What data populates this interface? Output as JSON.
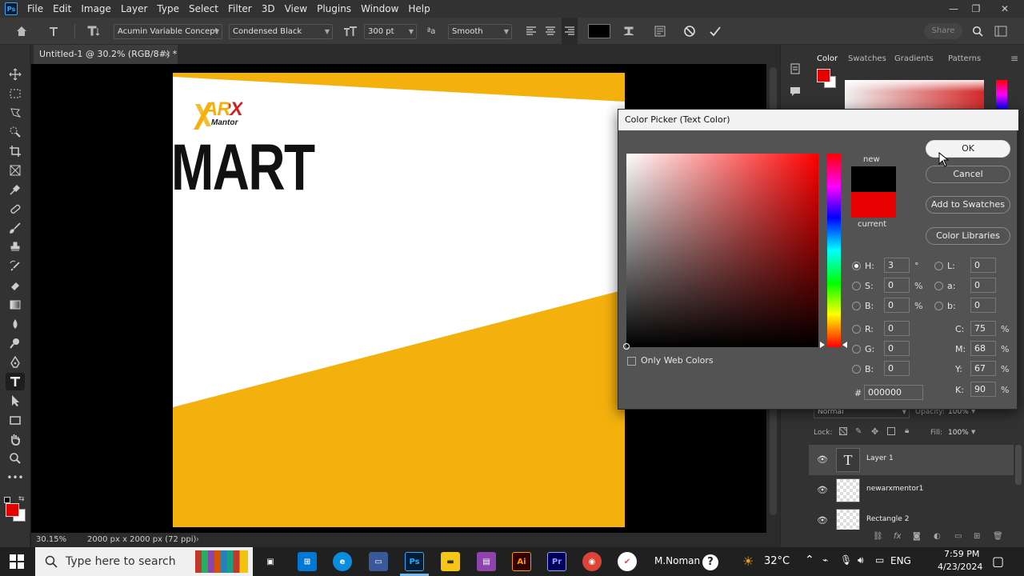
{
  "app": {
    "logo": "Ps",
    "menu": [
      "File",
      "Edit",
      "Image",
      "Layer",
      "Type",
      "Select",
      "Filter",
      "3D",
      "View",
      "Plugins",
      "Window",
      "Help"
    ],
    "window_controls": {
      "minimize": "—",
      "maximize": "❐",
      "close": "✕"
    }
  },
  "options_bar": {
    "font_family": "Acumin Variable Concept",
    "font_style": "Condensed Black",
    "font_size": "300 pt",
    "aa_label": "ªa",
    "anti_alias": "Smooth",
    "share": "Share",
    "text_color": "#000000"
  },
  "document": {
    "tab_title": "Untitled-1 @ 30.2% (RGB/8#) *",
    "headline_text": "MART",
    "logo_letters": "ARX",
    "logo_sub": "Mantor",
    "accent_color": "#f4b10d",
    "zoom": "30.15%",
    "doc_size": "2000 px x 2000 px (72 ppi)"
  },
  "right_panel": {
    "tabs": [
      "Color",
      "Swatches",
      "Gradients",
      "Patterns"
    ],
    "foreground_color": "#e60000",
    "blend_mode": "Normal",
    "opacity_label": "Opacity:",
    "opacity": "100%",
    "lock_label": "Lock:",
    "fill_label": "Fill:",
    "fill": "100%",
    "layers": [
      {
        "name": "Layer 1",
        "type": "text",
        "selected": true
      },
      {
        "name": "newarxmentor1",
        "type": "smart",
        "selected": false
      },
      {
        "name": "Rectangle 2",
        "type": "shape",
        "selected": false
      }
    ]
  },
  "color_picker": {
    "title": "Color Picker (Text Color)",
    "new_label": "new",
    "current_label": "current",
    "new_color": "#000000",
    "current_color": "#e60000",
    "buttons": {
      "ok": "OK",
      "cancel": "Cancel",
      "add_swatches": "Add to Swatches",
      "libraries": "Color Libraries"
    },
    "only_web_colors": "Only Web Colors",
    "fields": {
      "H": "3",
      "S": "0",
      "B": "0",
      "R": "0",
      "G": "0",
      "B2": "0",
      "L": "0",
      "a": "0",
      "b": "0",
      "C": "75",
      "M": "68",
      "Y": "67",
      "K": "90"
    },
    "units": {
      "deg": "°",
      "pct": "%"
    },
    "hex_label": "#",
    "hex": "000000"
  },
  "taskbar": {
    "search_placeholder": "Type here to search",
    "user": "M.Noman",
    "temperature": "32°C",
    "language": "ENG",
    "time": "7:59 PM",
    "date": "4/23/2024",
    "app_labels": {
      "photoshop": "Ps",
      "illustrator": "Ai",
      "premiere": "Pr"
    }
  }
}
